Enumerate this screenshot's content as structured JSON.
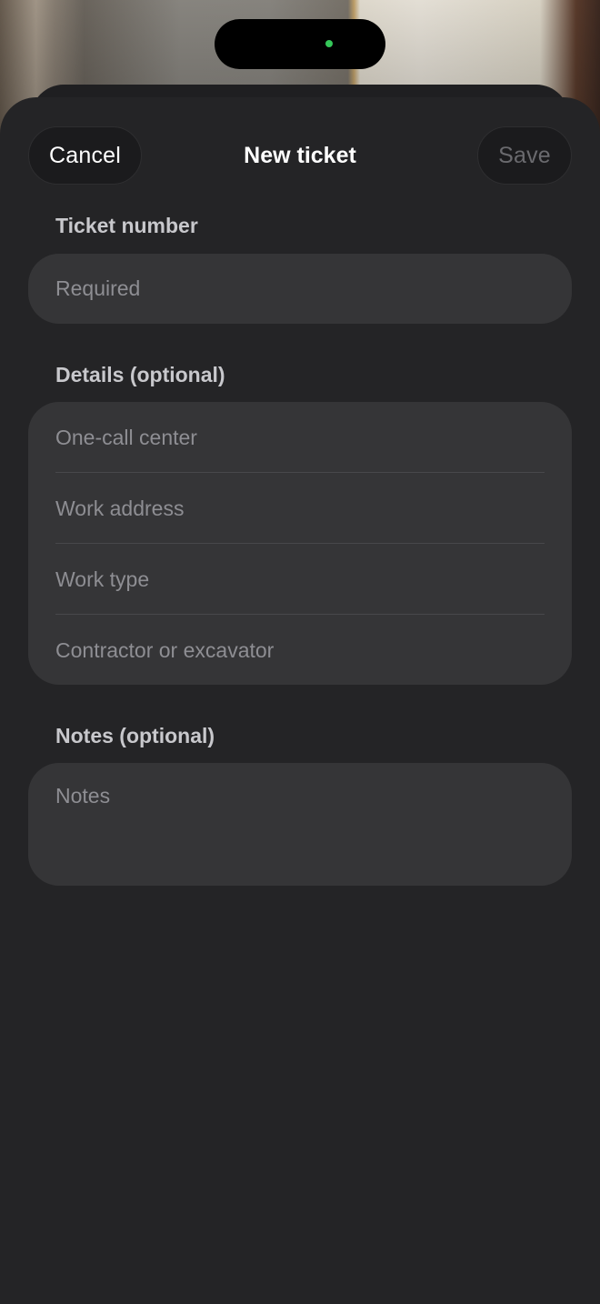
{
  "header": {
    "cancel_label": "Cancel",
    "title": "New ticket",
    "save_label": "Save"
  },
  "ticket_number": {
    "label": "Ticket number",
    "placeholder": "Required"
  },
  "details": {
    "label": "Details (optional)",
    "fields": [
      {
        "placeholder": "One-call center"
      },
      {
        "placeholder": "Work address"
      },
      {
        "placeholder": "Work type"
      },
      {
        "placeholder": "Contractor or excavator"
      }
    ]
  },
  "notes": {
    "label": "Notes (optional)",
    "placeholder": "Notes"
  },
  "colors": {
    "sheet_background": "#242426",
    "field_background": "#353537",
    "placeholder_text": "#8e8e93",
    "camera_indicator": "#35c759"
  }
}
